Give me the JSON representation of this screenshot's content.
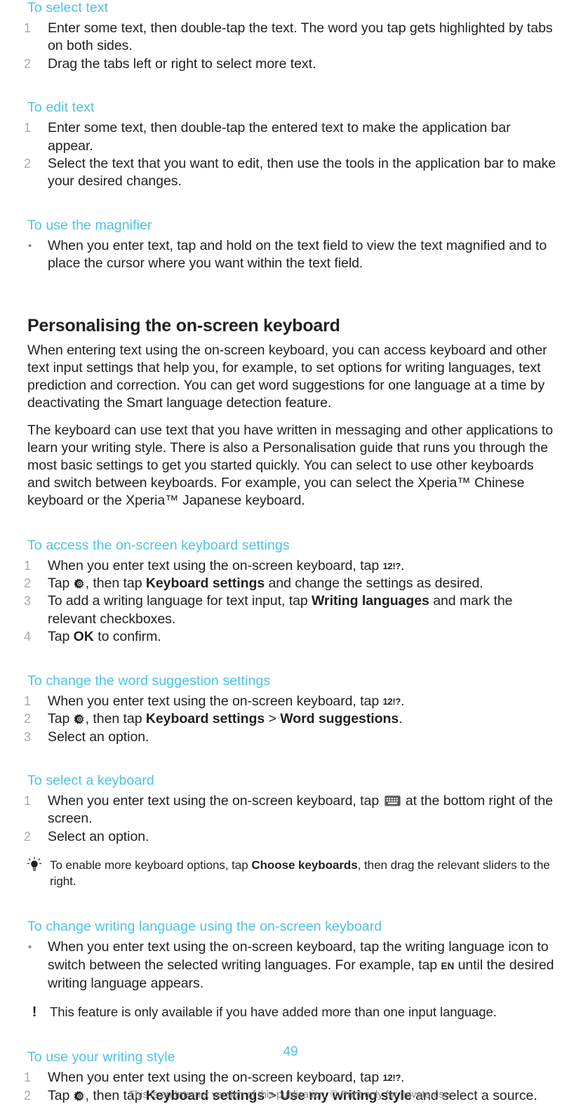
{
  "document": {
    "page_number": "49",
    "footer": "This is an Internet version of this publication. © Print only for private use.",
    "accent_color": "#4cc2e6",
    "text_color": "#231f20",
    "marker_color": "#a7a9ac",
    "footer_color": "#808285"
  },
  "sections": {
    "select_text": {
      "heading": "To select text",
      "steps": [
        {
          "marker": "1",
          "text": "Enter some text, then double-tap the text. The word you tap gets highlighted by tabs on both sides."
        },
        {
          "marker": "2",
          "text": "Drag the tabs left or right to select more text."
        }
      ]
    },
    "edit_text": {
      "heading": "To edit text",
      "steps": [
        {
          "marker": "1",
          "text": "Enter some text, then double-tap the entered text to make the application bar appear."
        },
        {
          "marker": "2",
          "text": "Select the text that you want to edit, then use the tools in the application bar to make your desired changes."
        }
      ]
    },
    "magnifier": {
      "heading": "To use the magnifier",
      "steps": [
        {
          "marker": "•",
          "text": "When you enter text, tap and hold on the text field to view the text magnified and to place the cursor where you want within the text field."
        }
      ]
    },
    "personalising": {
      "heading": "Personalising the on-screen keyboard",
      "paragraphs": [
        "When entering text using the on-screen keyboard, you can access keyboard and other text input settings that help you, for example, to set options for writing languages, text prediction and correction. You can get word suggestions for one language at a time by deactivating the Smart language detection feature.",
        "The keyboard can use text that you have written in messaging and other applications to learn your writing style. There is also a Personalisation guide that runs you through the most basic settings to get you started quickly. You can select to use other keyboards and switch between keyboards. For example, you can select the Xperia™ Chinese keyboard or the Xperia™ Japanese keyboard."
      ]
    },
    "access_settings": {
      "heading": "To access the on-screen keyboard settings",
      "step1": {
        "marker": "1",
        "prefix": "When you enter text using the on-screen keyboard, tap ",
        "icon": "12!?",
        "suffix": "."
      },
      "step2": {
        "marker": "2",
        "prefix": "Tap ",
        "icon_name": "gear-icon",
        "mid": ", then tap ",
        "ui1": "Keyboard settings",
        "suffix": " and change the settings as desired."
      },
      "step3": {
        "marker": "3",
        "prefix": "To add a writing language for text input, tap ",
        "ui1": "Writing languages",
        "suffix": " and mark the relevant checkboxes."
      },
      "step4": {
        "marker": "4",
        "prefix": "Tap ",
        "ui1": "OK",
        "suffix": " to confirm."
      }
    },
    "word_suggestion": {
      "heading": "To change the word suggestion settings",
      "step1": {
        "marker": "1",
        "prefix": "When you enter text using the on-screen keyboard, tap ",
        "icon": "12!?",
        "suffix": "."
      },
      "step2": {
        "marker": "2",
        "prefix": "Tap ",
        "icon_name": "gear-icon",
        "mid": ", then tap ",
        "ui1": "Keyboard settings",
        "separator": " > ",
        "ui2": "Word suggestions",
        "suffix": "."
      },
      "step3": {
        "marker": "3",
        "text": "Select an option."
      }
    },
    "select_keyboard": {
      "heading": "To select a keyboard",
      "step1": {
        "marker": "1",
        "prefix": "When you enter text using the on-screen keyboard, tap ",
        "icon_name": "keyboard-icon",
        "suffix": " at the bottom right of the screen."
      },
      "step2": {
        "marker": "2",
        "text": "Select an option."
      },
      "tip": {
        "icon_name": "lightbulb-tip-icon",
        "prefix": "To enable more keyboard options, tap ",
        "ui1": "Choose keyboards",
        "suffix": ", then drag the relevant sliders to the right."
      }
    },
    "change_writing_language": {
      "heading": "To change writing language using the on-screen keyboard",
      "step1": {
        "marker": "•",
        "prefix": "When you enter text using the on-screen keyboard, tap the writing language icon to switch between the selected writing languages. For example, tap ",
        "icon": "EN",
        "suffix": " until the desired writing language appears."
      },
      "note": {
        "icon_name": "exclamation-note-icon",
        "text": "This feature is only available if you have added more than one input language."
      }
    },
    "writing_style": {
      "heading": "To use your writing style",
      "step1": {
        "marker": "1",
        "prefix": "When you enter text using the on-screen keyboard, tap ",
        "icon": "12!?",
        "suffix": "."
      },
      "step2": {
        "marker": "2",
        "prefix": "Tap ",
        "icon_name": "gear-icon",
        "mid": ", then tap ",
        "ui1": "Keyboard settings",
        "separator": " > ",
        "ui2": "Use my writing style",
        "suffix": " and select a source."
      }
    }
  }
}
